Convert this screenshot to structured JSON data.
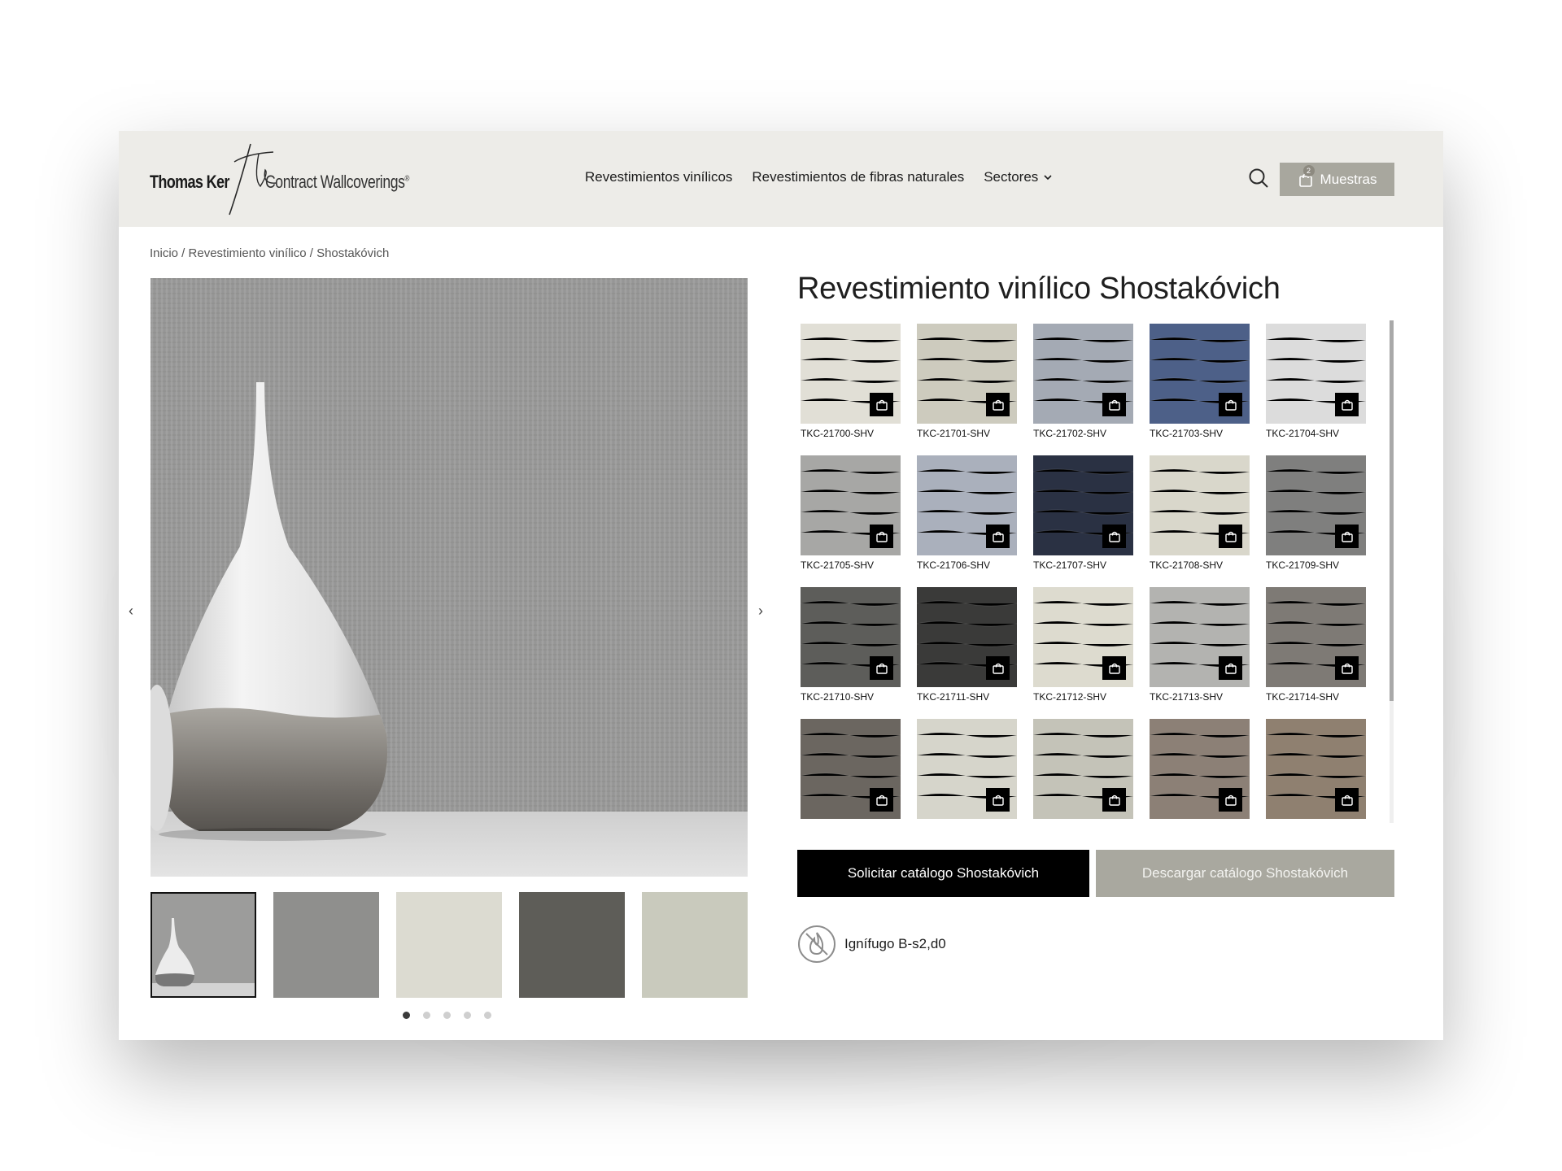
{
  "header": {
    "logo_name": "Thomas Ker",
    "logo_mark": "Tk",
    "logo_tagline": "Contract Wallcoverings",
    "logo_registered": "®",
    "nav": [
      {
        "label": "Revestimientos vinílicos"
      },
      {
        "label": "Revestimientos de fibras naturales"
      },
      {
        "label": "Sectores",
        "has_dropdown": true
      }
    ],
    "samples_label": "Muestras",
    "samples_count": "2"
  },
  "breadcrumb": "Inicio / Revestimiento vinílico / Shostakóvich",
  "gallery": {
    "prev_arrow": "‹",
    "next_arrow": "›",
    "thumbnails": [
      {
        "kind": "vase",
        "active": true
      },
      {
        "color": "#8f8f8d"
      },
      {
        "color": "#dcdbd1"
      },
      {
        "color": "#5e5d58"
      },
      {
        "color": "#c9cabd"
      }
    ],
    "pages": 5,
    "active_page": 1
  },
  "product": {
    "title": "Revestimiento vinílico Shostakóvich",
    "swatches": [
      {
        "code": "TKC-21700-SHV",
        "color": "#e1dfd6"
      },
      {
        "code": "TKC-21701-SHV",
        "color": "#cdcbbe"
      },
      {
        "code": "TKC-21702-SHV",
        "color": "#a4aab4"
      },
      {
        "code": "TKC-21703-SHV",
        "color": "#4d6088"
      },
      {
        "code": "TKC-21704-SHV",
        "color": "#dcdcdc"
      },
      {
        "code": "TKC-21705-SHV",
        "color": "#a7a7a5"
      },
      {
        "code": "TKC-21706-SHV",
        "color": "#aab0bc"
      },
      {
        "code": "TKC-21707-SHV",
        "color": "#2a3143"
      },
      {
        "code": "TKC-21708-SHV",
        "color": "#d9d7cb"
      },
      {
        "code": "TKC-21709-SHV",
        "color": "#7f7f7e"
      },
      {
        "code": "TKC-21710-SHV",
        "color": "#5d5d5a"
      },
      {
        "code": "TKC-21711-SHV",
        "color": "#3a3a39"
      },
      {
        "code": "TKC-21712-SHV",
        "color": "#dddbcf"
      },
      {
        "code": "TKC-21713-SHV",
        "color": "#b3b3b0"
      },
      {
        "code": "TKC-21714-SHV",
        "color": "#7e7a75"
      },
      {
        "code": "",
        "color": "#6b6660"
      },
      {
        "code": "",
        "color": "#d6d5cb"
      },
      {
        "code": "",
        "color": "#c4c3b8"
      },
      {
        "code": "",
        "color": "#8c8076"
      },
      {
        "code": "",
        "color": "#8f8070"
      }
    ],
    "request_label": "Solicitar catálogo Shostakóvich",
    "download_label": "Descargar catálogo Shostakóvich",
    "fire_rating": "Ignífugo B-s2,d0"
  },
  "colors": {
    "header_bg": "#edece8",
    "accent_button": "#a8a79e",
    "primary_button": "#000000"
  }
}
